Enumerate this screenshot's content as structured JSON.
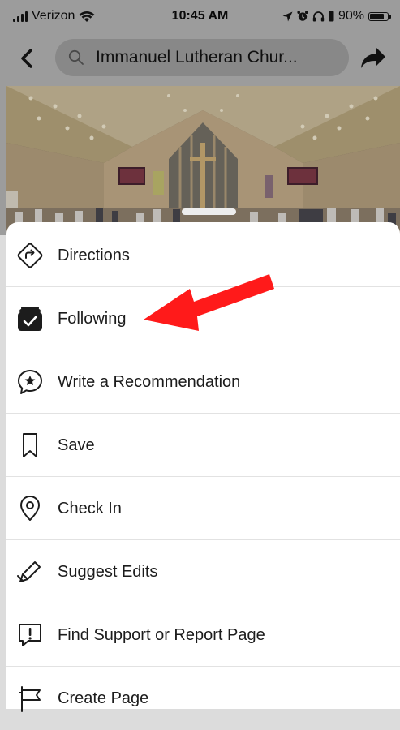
{
  "status_bar": {
    "carrier": "Verizon",
    "time": "10:45 AM",
    "battery_text": "90%",
    "battery_level": 0.9
  },
  "nav": {
    "search_text": "Immanuel Lutheran Chur..."
  },
  "menu": [
    {
      "label": "Directions",
      "icon": "directions-icon"
    },
    {
      "label": "Following",
      "icon": "following-check-icon"
    },
    {
      "label": "Write a Recommendation",
      "icon": "recommendation-star-icon"
    },
    {
      "label": "Save",
      "icon": "bookmark-icon"
    },
    {
      "label": "Check In",
      "icon": "location-pin-icon"
    },
    {
      "label": "Suggest Edits",
      "icon": "pencil-icon"
    },
    {
      "label": "Find Support or Report Page",
      "icon": "report-icon"
    },
    {
      "label": "Create Page",
      "icon": "flag-icon"
    }
  ],
  "colors": {
    "annotation_arrow": "#ff1a1a",
    "overlay": "#9c9c9c",
    "sheet": "#ffffff"
  }
}
